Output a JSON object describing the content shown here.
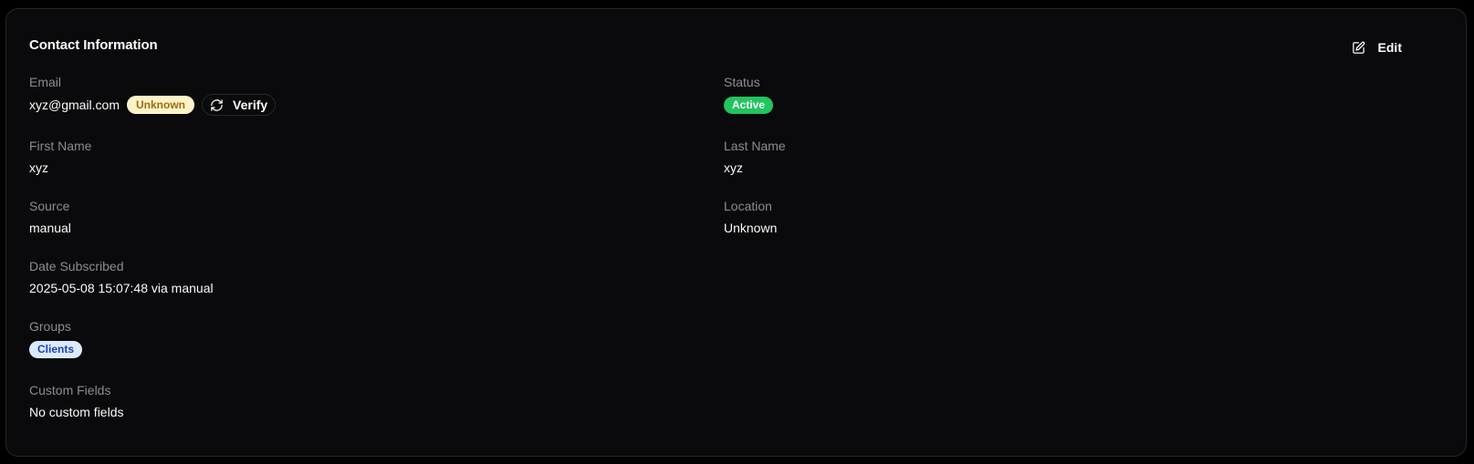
{
  "card": {
    "title": "Contact Information",
    "edit_label": "Edit"
  },
  "email": {
    "label": "Email",
    "value": "xyz@gmail.com",
    "verification_badge": "Unknown",
    "verify_label": "Verify"
  },
  "status": {
    "label": "Status",
    "value": "Active"
  },
  "first_name": {
    "label": "First Name",
    "value": "xyz"
  },
  "last_name": {
    "label": "Last Name",
    "value": "xyz"
  },
  "source": {
    "label": "Source",
    "value": "manual"
  },
  "location": {
    "label": "Location",
    "value": "Unknown"
  },
  "date_subscribed": {
    "label": "Date Subscribed",
    "value": "2025-05-08 15:07:48 via manual"
  },
  "groups": {
    "label": "Groups",
    "items": [
      "Clients"
    ]
  },
  "custom_fields": {
    "label": "Custom Fields",
    "empty_text": "No custom fields"
  },
  "icons": {
    "edit": "edit-icon",
    "verify": "refresh-icon"
  },
  "colors": {
    "background": "#0a0a0c",
    "border": "#27272a",
    "label": "#8b8b95",
    "text": "#fafafa",
    "badge_unknown_bg": "#fef3c7",
    "badge_unknown_text": "#9a6b14",
    "badge_active_bg": "#22c55e",
    "badge_group_bg": "#dbeafe",
    "badge_group_text": "#1e40af"
  }
}
